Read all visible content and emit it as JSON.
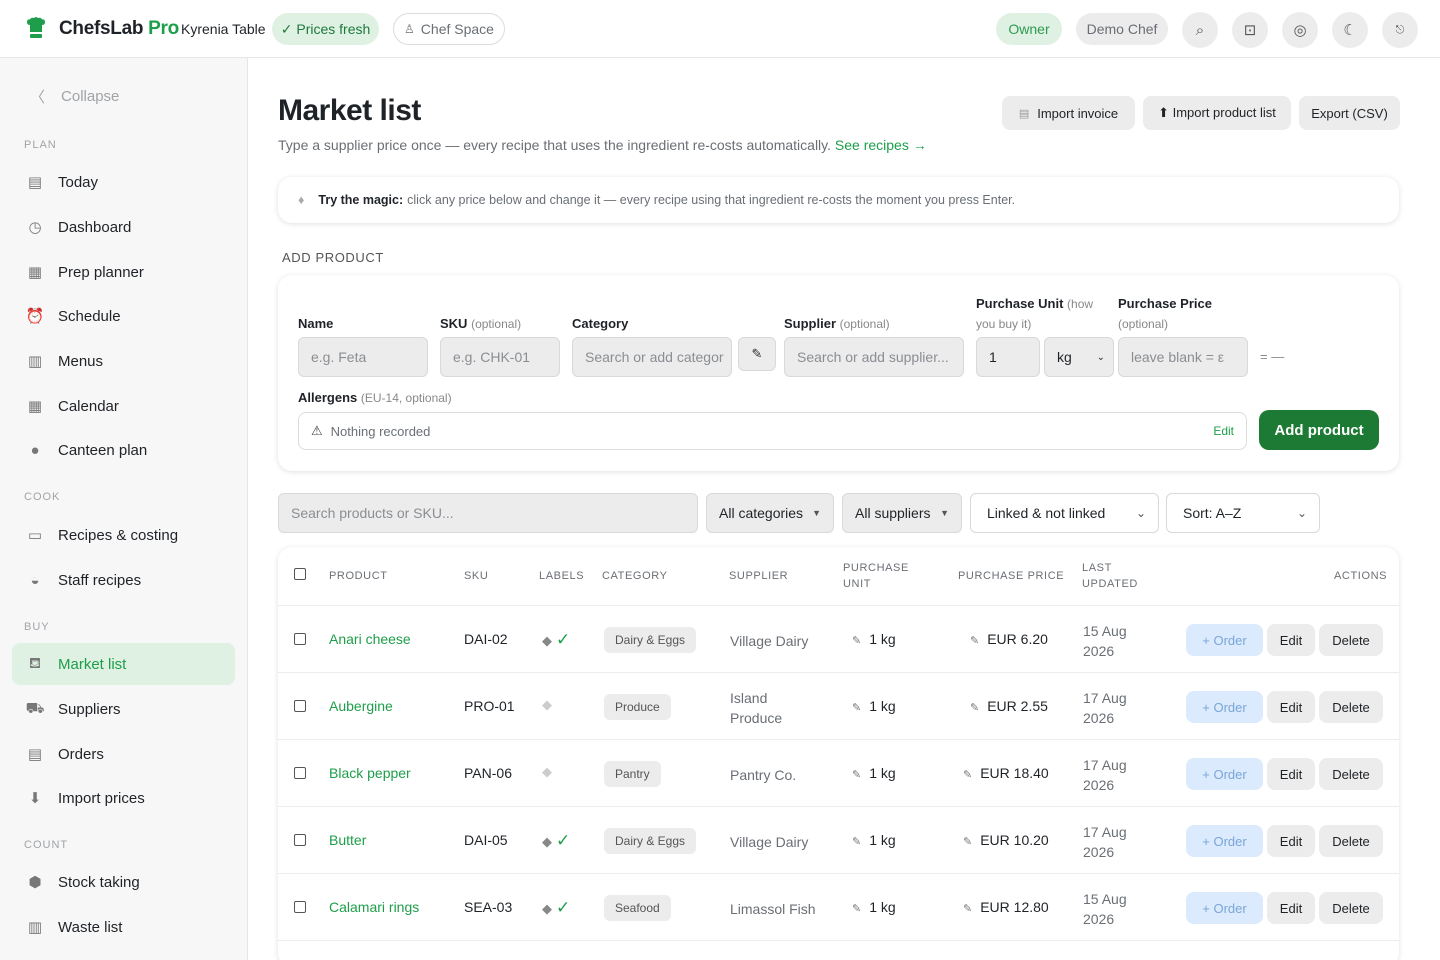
{
  "app": {
    "brand_main": "ChefsLab",
    "brand_suffix": "Pro",
    "venue": "Kyrenia Table",
    "prices_fresh": "✓ Prices fresh",
    "chef_space": "Chef Space",
    "role": "Owner",
    "user": "Demo Chef",
    "accent": "#1e9e4a"
  },
  "sidebar": {
    "collapse": "Collapse",
    "sections": {
      "plan": "PLAN",
      "cook": "COOK",
      "buy": "BUY",
      "count": "COUNT"
    },
    "items": [
      {
        "label": "Today",
        "icon": "clipboard-icon"
      },
      {
        "label": "Dashboard",
        "icon": "clock-icon"
      },
      {
        "label": "Prep planner",
        "icon": "list-icon"
      },
      {
        "label": "Schedule",
        "icon": "alarm-icon"
      },
      {
        "label": "Menus",
        "icon": "menu-card-icon"
      },
      {
        "label": "Calendar",
        "icon": "calendar-icon"
      },
      {
        "label": "Canteen plan",
        "icon": "globe-icon"
      },
      {
        "label": "Recipes & costing",
        "icon": "book-icon"
      },
      {
        "label": "Staff recipes",
        "icon": "bowl-icon"
      },
      {
        "label": "Market list",
        "icon": "basket-icon"
      },
      {
        "label": "Suppliers",
        "icon": "truck-icon"
      },
      {
        "label": "Orders",
        "icon": "receipt-icon"
      },
      {
        "label": "Import prices",
        "icon": "inbox-icon"
      },
      {
        "label": "Stock taking",
        "icon": "box-icon"
      },
      {
        "label": "Waste list",
        "icon": "trash-icon"
      }
    ]
  },
  "page": {
    "title": "Market list",
    "subtitle": "Type a supplier price once — every recipe that uses the ingredient re-costs automatically.",
    "subtitle_link": "See recipes →",
    "import_invoice": "Import invoice",
    "import_product_list": "⬆ Import product list",
    "export_csv": "Export (CSV)",
    "tip_bold": "Try the magic:",
    "tip_text": "click any price below and change it — every recipe using that ingredient re-costs the moment you press Enter.",
    "add_product_heading": "ADD PRODUCT"
  },
  "form": {
    "name_label": "Name",
    "name_placeholder": "e.g. Feta",
    "sku_label": "SKU",
    "sku_opt": "(optional)",
    "sku_placeholder": "e.g. CHK-01",
    "category_label": "Category",
    "category_placeholder": "Search or add categor",
    "supplier_label": "Supplier",
    "supplier_opt": "(optional)",
    "supplier_placeholder": "Search or add supplier...",
    "unit_label": "Purchase Unit",
    "unit_opt_1": "(how",
    "unit_opt_2": "you buy it)",
    "unit_qty": "1",
    "unit_value": "kg",
    "price_label": "Purchase Price",
    "price_opt": "(optional)",
    "price_placeholder": "leave blank = ε",
    "equals": "= —",
    "allergens_label": "Allergens",
    "allergens_opt": "(EU-14, optional)",
    "allergens_value": "Nothing recorded",
    "allergens_edit": "Edit",
    "add_button": "Add product"
  },
  "filters": {
    "search_placeholder": "Search products or SKU...",
    "categories": "All categories",
    "suppliers": "All suppliers",
    "linked": "Linked & not linked",
    "sort": "Sort: A–Z"
  },
  "table": {
    "headers": {
      "product": "PRODUCT",
      "sku": "SKU",
      "labels": "LABELS",
      "category": "CATEGORY",
      "supplier": "SUPPLIER",
      "unit_1": "PURCHASE",
      "unit_2": "UNIT",
      "price": "PURCHASE PRICE",
      "updated_1": "LAST",
      "updated_2": "UPDATED",
      "actions": "ACTIONS"
    },
    "order_label": "+ Order",
    "edit_label": "Edit",
    "delete_label": "Delete",
    "rows": [
      {
        "product": "Anari cheese",
        "sku": "DAI-02",
        "linked": true,
        "category": "Dairy & Eggs",
        "supplier_1": "Village Dairy",
        "supplier_2": "",
        "unit": "1 kg",
        "price": "EUR 6.20",
        "date_1": "15 Aug",
        "date_2": "2026"
      },
      {
        "product": "Aubergine",
        "sku": "PRO-01",
        "linked": false,
        "category": "Produce",
        "supplier_1": "Island",
        "supplier_2": "Produce",
        "unit": "1 kg",
        "price": "EUR 2.55",
        "date_1": "17 Aug",
        "date_2": "2026"
      },
      {
        "product": "Black pepper",
        "sku": "PAN-06",
        "linked": false,
        "category": "Pantry",
        "supplier_1": "Pantry Co.",
        "supplier_2": "",
        "unit": "1 kg",
        "price": "EUR 18.40",
        "date_1": "17 Aug",
        "date_2": "2026"
      },
      {
        "product": "Butter",
        "sku": "DAI-05",
        "linked": true,
        "category": "Dairy & Eggs",
        "supplier_1": "Village Dairy",
        "supplier_2": "",
        "unit": "1 kg",
        "price": "EUR 10.20",
        "date_1": "17 Aug",
        "date_2": "2026"
      },
      {
        "product": "Calamari rings",
        "sku": "SEA-03",
        "linked": true,
        "category": "Seafood",
        "supplier_1": "Limassol Fish",
        "supplier_2": "",
        "unit": "1 kg",
        "price": "EUR 12.80",
        "date_1": "15 Aug",
        "date_2": "2026"
      }
    ]
  }
}
